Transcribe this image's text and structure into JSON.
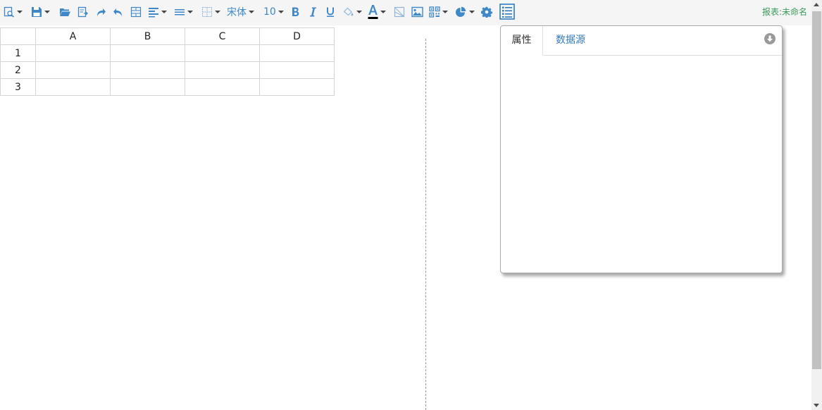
{
  "toolbar": {
    "font_family": "宋体",
    "font_size": "10",
    "report_name": "报表:未命名",
    "icons": [
      "preview-icon",
      "save-icon",
      "open-folder-icon",
      "export-icon",
      "redo-icon",
      "undo-icon",
      "merge-cells-icon",
      "align-left-icon",
      "line-height-icon",
      "border-icon",
      "bold-icon",
      "italic-icon",
      "underline-icon",
      "fill-color-icon",
      "font-color-icon",
      "slash-cell-icon",
      "image-icon",
      "qrcode-icon",
      "chart-icon",
      "settings-icon",
      "property-panel-icon"
    ],
    "font_color": "#000000",
    "icon_color": "#3e88c9"
  },
  "sheet": {
    "columns": [
      "A",
      "B",
      "C",
      "D"
    ],
    "rows": [
      "1",
      "2",
      "3"
    ]
  },
  "panel": {
    "tabs": [
      {
        "label": "属性",
        "active": true
      },
      {
        "label": "数据源",
        "active": false
      }
    ]
  }
}
